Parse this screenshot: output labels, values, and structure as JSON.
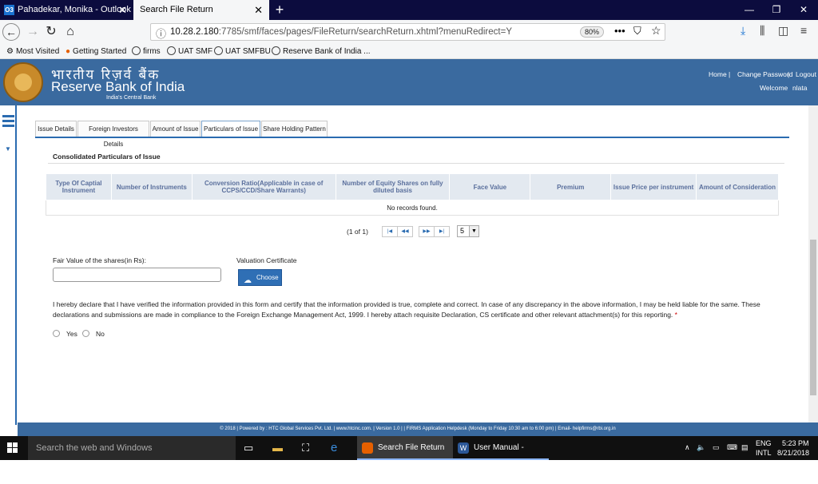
{
  "browser": {
    "tabs": [
      {
        "label": "Pahadekar, Monika - Outlook W",
        "icon": "O3"
      },
      {
        "label": "Search File Return"
      }
    ],
    "url_host": "10.28.2.180",
    "url_rest": ":7785/smf/faces/pages/FileReturn/searchReturn.xhtml?menuRedirect=Y",
    "zoom": "80%",
    "bookmarks": [
      "Most Visited",
      "Getting Started",
      "firms",
      "UAT SMF",
      "UAT SMFBU",
      "Reserve Bank of India ..."
    ]
  },
  "header": {
    "hindi": "भारतीय रिज़र्व बैंक",
    "english": "Reserve Bank of India",
    "tagline": "India's Central Bank",
    "home": "Home",
    "change_password": "Change Password",
    "logout": "Logout",
    "welcome": "Welcome",
    "user": "nlata"
  },
  "tabs": [
    "Issue Details",
    "Foreign Investors Details",
    "Amount of Issue",
    "Particulars of Issue",
    "Share Holding Pattern"
  ],
  "section_title": "Consolidated Particulars of Issue",
  "table": {
    "columns": [
      "Type Of Captial Instrument",
      "Number of Instruments",
      "Conversion Ratio(Applicable in case of CCPS/CCD/Share Warrants)",
      "Number of Equity Shares on fully diluted basis",
      "Face Value",
      "Premium",
      "Issue Price per instrument",
      "Amount of Consideration"
    ],
    "empty": "No records found."
  },
  "pager": {
    "text": "(1 of 1)",
    "rows": "5"
  },
  "form": {
    "fair_value_label": "Fair Value of the shares(in Rs):",
    "valuation_label": "Valuation Certificate",
    "choose": "Choose",
    "declaration": "I hereby declare that I have verified the information provided in this form and certify that the information provided is true, complete and correct. In case of any discrepancy in the above information, I may be held liable for the same. These declarations and submissions are made in compliance to the Foreign Exchange Management Act, 1999. I hereby attach requisite Declaration, CS certificate and other relevant attachment(s) for this reporting.",
    "required": "*",
    "yes": "Yes",
    "no": "No"
  },
  "footer": "© 2018 | Powered by : HTC Global Services Pvt. Ltd. | www.htcinc.com. | Version 1.0 | | FIRMS Application Helpdesk (Monday to Friday 10:30 am to 6:00 pm) | Email- helpfirms@rbi.org.in",
  "taskbar": {
    "search": "Search the web and Windows",
    "app1": "Search File Return -...",
    "app2": "User Manual - FOR...",
    "lang1": "ENG",
    "lang2": "INTL",
    "time": "5:23 PM",
    "date": "8/21/2018"
  }
}
